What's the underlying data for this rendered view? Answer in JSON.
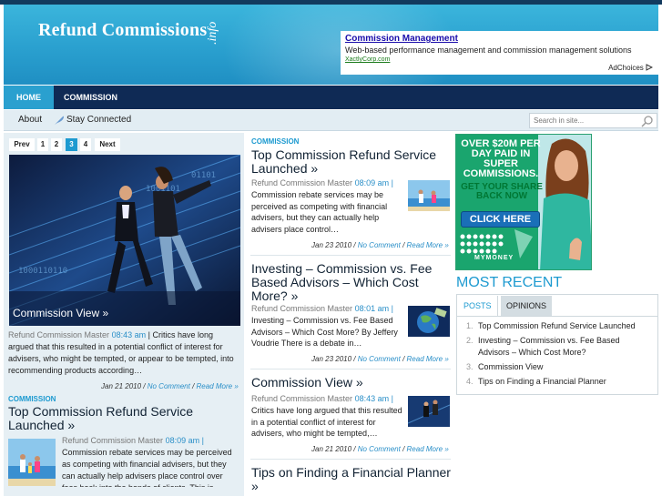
{
  "site": {
    "name": "Refund Commissions",
    "tld": ".info"
  },
  "ad": {
    "title": "Commission Management",
    "description": "Web-based performance management and commission management solutions",
    "url": "XactlyCorp.com",
    "choices": "AdChoices"
  },
  "nav_primary": [
    {
      "label": "HOME",
      "active": true
    },
    {
      "label": "COMMISSION",
      "active": false
    }
  ],
  "nav_secondary": [
    {
      "label": "About"
    },
    {
      "label": "Stay Connected"
    }
  ],
  "search": {
    "placeholder": "Search in site..."
  },
  "slider": {
    "pager": [
      "Prev",
      "1",
      "2",
      "3",
      "4",
      "Next"
    ],
    "current": "3",
    "caption": "Commission View »"
  },
  "left_post_1": {
    "author": "Refund Commission Master",
    "time": "08:43 am",
    "excerpt": "| Critics have long argued that this resulted in a potential conflict of interest for advisers, who might be tempted, or appear to be tempted, into recommending products according…",
    "date": "Jan 21 2010",
    "comments": "No Comment",
    "more": "Read More »"
  },
  "left_post_2": {
    "category": "COMMISSION",
    "title": "Top Commission Refund Service Launched »",
    "author": "Refund Commission Master",
    "time": "08:09 am",
    "excerpt": "Commission rebate services may be perceived as competing with financial advisers, but they can actually help advisers place control over fees back into the hands of clients. This is according to MyMoney"
  },
  "middle_posts": [
    {
      "category": "COMMISSION",
      "title": "Top Commission Refund Service Launched »",
      "author": "Refund Commission Master",
      "time": "08:09 am |",
      "excerpt": "Commission rebate services may be perceived as competing with financial advisers, but they can actually help advisers place control…",
      "date": "Jan 23 2010",
      "comments": "No Comment",
      "more": "Read More »"
    },
    {
      "title": "Investing – Commission vs. Fee Based Advisors – Which Cost More? »",
      "author": "Refund Commission Master",
      "time": "08:01 am |",
      "excerpt": "Investing – Commission vs. Fee Based Advisors – Which Cost More? By Jeffery Voudrie There is a debate in…",
      "date": "Jan 23 2010",
      "comments": "No Comment",
      "more": "Read More »"
    },
    {
      "title": "Commission View »",
      "author": "Refund Commission Master",
      "time": "08:43 am |",
      "excerpt": "Critics have long argued that this resulted in a potential conflict of interest for advisers, who might be tempted,…",
      "date": "Jan 21 2010",
      "comments": "No Comment",
      "more": "Read More »"
    },
    {
      "title": "Tips on Finding a Financial Planner »"
    }
  ],
  "banner": {
    "line1": "OVER $20M PER DAY PAID IN SUPER COMMISSIONS.",
    "line2": "GET YOUR SHARE BACK NOW",
    "button": "CLICK HERE",
    "brand": "MYMONEY"
  },
  "recent": {
    "title": "MOST RECENT",
    "tabs": [
      "POSTS",
      "OPINIONS"
    ],
    "items": [
      {
        "n": "1.",
        "label": "Top Commission Refund Service Launched"
      },
      {
        "n": "2.",
        "label": "Investing – Commission vs. Fee Based Advisors – Which Cost More?"
      },
      {
        "n": "3.",
        "label": "Commission View"
      },
      {
        "n": "4.",
        "label": "Tips on Finding a Financial Planner"
      }
    ]
  }
}
